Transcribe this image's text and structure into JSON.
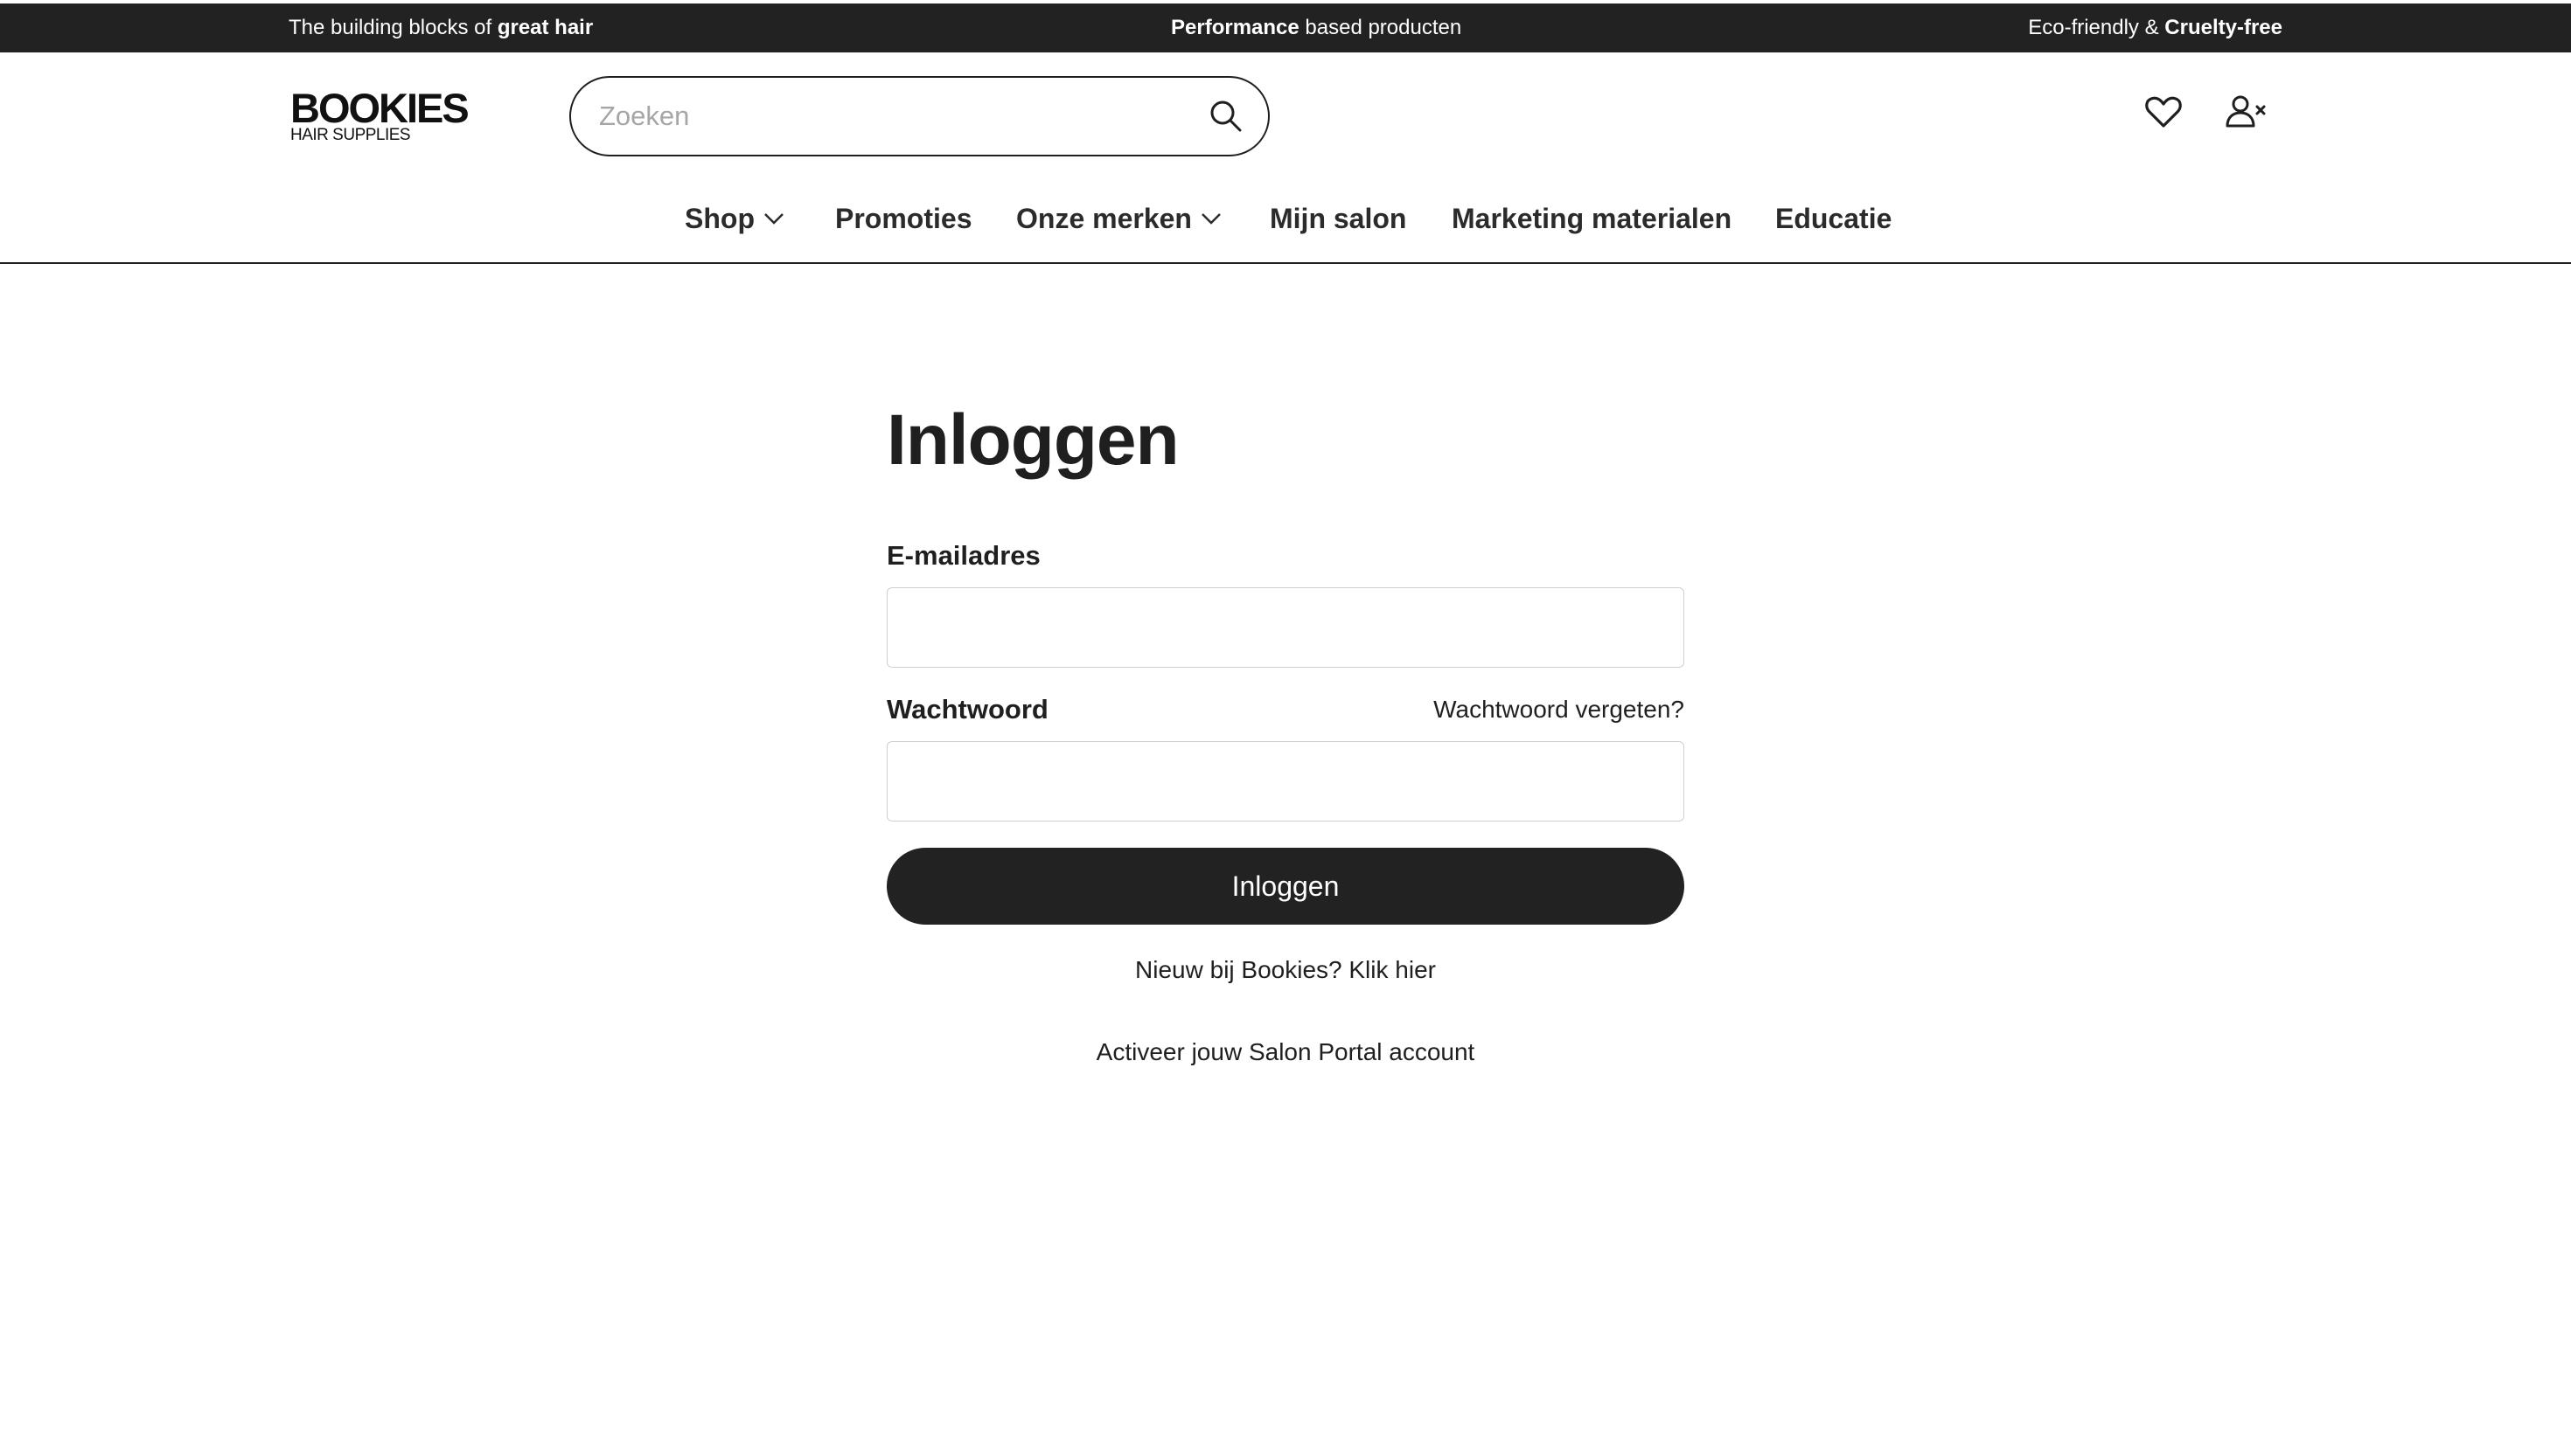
{
  "announcement_bar": {
    "left_prefix": "The building blocks of ",
    "left_bold": "great hair",
    "center_bold": "Performance",
    "center_suffix": " based producten",
    "right_prefix": "Eco-friendly & ",
    "right_bold": "Cruelty-free"
  },
  "header": {
    "logo": {
      "brand": "BOOKIES",
      "sub": "HAIR SUPPLIES"
    },
    "search": {
      "placeholder": "Zoeken",
      "value": "",
      "icon": "search-icon"
    },
    "icons": {
      "wishlist": "heart-icon",
      "account": "user-x-icon"
    }
  },
  "nav": {
    "items": [
      {
        "label": "Shop",
        "has_dropdown": true
      },
      {
        "label": "Promoties",
        "has_dropdown": false
      },
      {
        "label": "Onze merken",
        "has_dropdown": true
      },
      {
        "label": "Mijn salon",
        "has_dropdown": false
      },
      {
        "label": "Marketing materialen",
        "has_dropdown": false
      },
      {
        "label": "Educatie",
        "has_dropdown": false
      }
    ]
  },
  "login": {
    "title": "Inloggen",
    "email_label": "E-mailadres",
    "email_value": "",
    "password_label": "Wachtwoord",
    "password_value": "",
    "forgot_link": "Wachtwoord vergeten?",
    "submit_label": "Inloggen",
    "register_link": "Nieuw bij Bookies? Klik hier",
    "activate_link": "Activeer jouw Salon Portal account"
  },
  "colors": {
    "dark": "#222222",
    "text": "#1f1f1f",
    "input_border": "#cfcfcf",
    "placeholder": "#a6a6a6",
    "background": "#ffffff"
  }
}
